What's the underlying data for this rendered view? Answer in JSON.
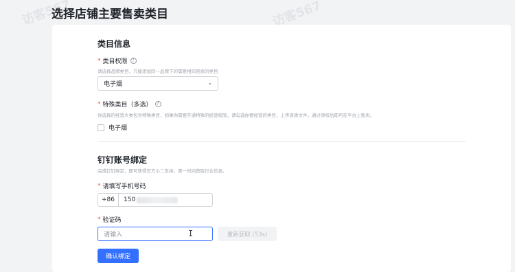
{
  "page": {
    "title": "选择店铺主要售卖类目",
    "watermark": "访客567"
  },
  "category_section": {
    "title": "类目信息",
    "category_permission": {
      "label": "类目权限",
      "required_mark": "*",
      "help_icon": "question-circle-icon",
      "hint": "请选择品牌类目，只能添加同一品牌下的需要相同资质的类目",
      "selected_value": "电子烟",
      "dropdown_icon": "chevron-down-icon"
    },
    "special_category": {
      "label": "特殊类目（多选）",
      "required_mark": "*",
      "help_icon": "question-circle-icon",
      "hint": "你选择的经营大类包含特殊类目，如果你需要开通特殊的经营权限，请勾选你要经营的类目，上传资质文件，通过审核后即可在平台上售卖。",
      "options": [
        {
          "label": "电子烟",
          "checked": false
        }
      ]
    }
  },
  "dingtalk_section": {
    "title": "钉钉账号绑定",
    "hint": "完成钉钉绑定，即可获得官方小二支持，第一时间获取行业信息。",
    "phone": {
      "label": "请填写手机号码",
      "required_mark": "*",
      "prefix": "+86",
      "value": "150"
    },
    "verification": {
      "label": "验证码",
      "required_mark": "*",
      "placeholder": "请输入",
      "resend_label": "重新获取 (53s)"
    },
    "confirm_label": "确认绑定"
  },
  "colors": {
    "primary": "#3370ff",
    "required": "#f54a45",
    "background": "#f2f3f5"
  }
}
